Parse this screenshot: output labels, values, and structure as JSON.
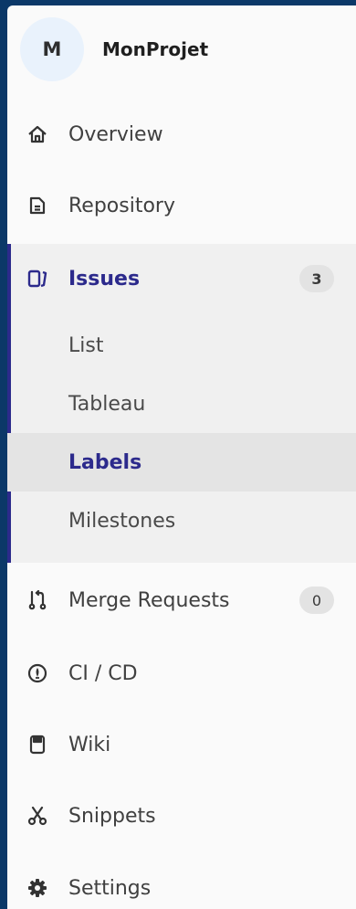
{
  "project": {
    "avatar_letter": "M",
    "name": "MonProjet"
  },
  "nav": {
    "overview": {
      "label": "Overview",
      "icon": "home-icon"
    },
    "repository": {
      "label": "Repository",
      "icon": "document-icon"
    },
    "issues": {
      "label": "Issues",
      "icon": "issues-icon",
      "count": "3",
      "subitems": [
        {
          "label": "List",
          "active": false
        },
        {
          "label": "Tableau",
          "active": false
        },
        {
          "label": "Labels",
          "active": true
        },
        {
          "label": "Milestones",
          "active": false
        }
      ]
    },
    "merge_requests": {
      "label": "Merge Requests",
      "icon": "merge-request-icon",
      "count": "0"
    },
    "ci_cd": {
      "label": "CI / CD",
      "icon": "rocket-icon"
    },
    "wiki": {
      "label": "Wiki",
      "icon": "book-icon"
    },
    "snippets": {
      "label": "Snippets",
      "icon": "scissors-icon"
    },
    "settings": {
      "label": "Settings",
      "icon": "gear-icon"
    }
  },
  "colors": {
    "accent": "#2c2a8c",
    "frame": "#0b3868"
  }
}
